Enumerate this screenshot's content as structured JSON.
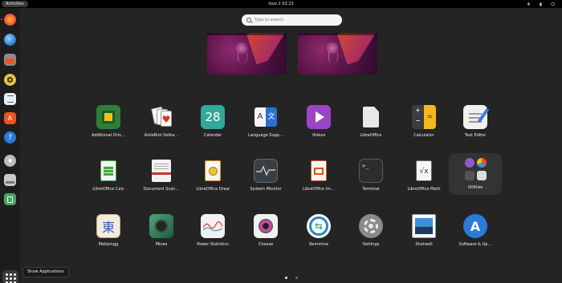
{
  "topbar": {
    "activities": "Activities",
    "clock": "Iouv 2  02:23",
    "tray_icons": [
      "network-icon",
      "volume-icon",
      "power-icon"
    ]
  },
  "search": {
    "placeholder": "Type to search"
  },
  "dock": {
    "tooltip": "Show Applications",
    "items": [
      "firefox-icon",
      "thunderbird-icon",
      "files-icon",
      "rhythmbox-icon",
      "writer-icon",
      "software-icon",
      "help-icon",
      "disc-icon",
      "drive-icon",
      "trash-icon"
    ]
  },
  "apps": [
    {
      "label": "Additional Driv…",
      "icon": "chip-icon"
    },
    {
      "label": "AisleRiot Solita…",
      "icon": "cards-icon"
    },
    {
      "label": "Calendar",
      "icon": "calendar-icon",
      "day": "28"
    },
    {
      "label": "Language Supp…",
      "icon": "language-icon"
    },
    {
      "label": "Videos",
      "icon": "play-icon"
    },
    {
      "label": "LibreOffice",
      "icon": "libreoffice-icon"
    },
    {
      "label": "Calculator",
      "icon": "calculator-icon"
    },
    {
      "label": "Text Editor",
      "icon": "text-editor-icon"
    },
    {
      "label": "LibreOffice Calc",
      "icon": "calc-icon"
    },
    {
      "label": "Document Scan…",
      "icon": "scanner-icon"
    },
    {
      "label": "LibreOffice Draw",
      "icon": "draw-icon"
    },
    {
      "label": "System Monitor",
      "icon": "monitor-icon"
    },
    {
      "label": "LibreOffice Im…",
      "icon": "impress-icon"
    },
    {
      "label": "Terminal",
      "icon": "terminal-icon"
    },
    {
      "label": "LibreOffice Math",
      "icon": "math-icon"
    },
    {
      "label": "Utilities",
      "icon": "utilities-folder-icon"
    },
    {
      "label": "Mahjongg",
      "icon": "mahjongg-icon",
      "glyph": "東"
    },
    {
      "label": "Mines",
      "icon": "mines-icon"
    },
    {
      "label": "Power Statistics",
      "icon": "power-stats-icon"
    },
    {
      "label": "Cheese",
      "icon": "cheese-icon"
    },
    {
      "label": "Remmina",
      "icon": "remmina-icon"
    },
    {
      "label": "Settings",
      "icon": "settings-icon"
    },
    {
      "label": "Shotwell",
      "icon": "shotwell-icon"
    },
    {
      "label": "Software & Up…",
      "icon": "software-updates-icon"
    }
  ],
  "pages": {
    "count": 2,
    "current": 1
  },
  "colors": {
    "background": "#242424",
    "accent": "#e95420",
    "dock": "#1d1d1d"
  }
}
